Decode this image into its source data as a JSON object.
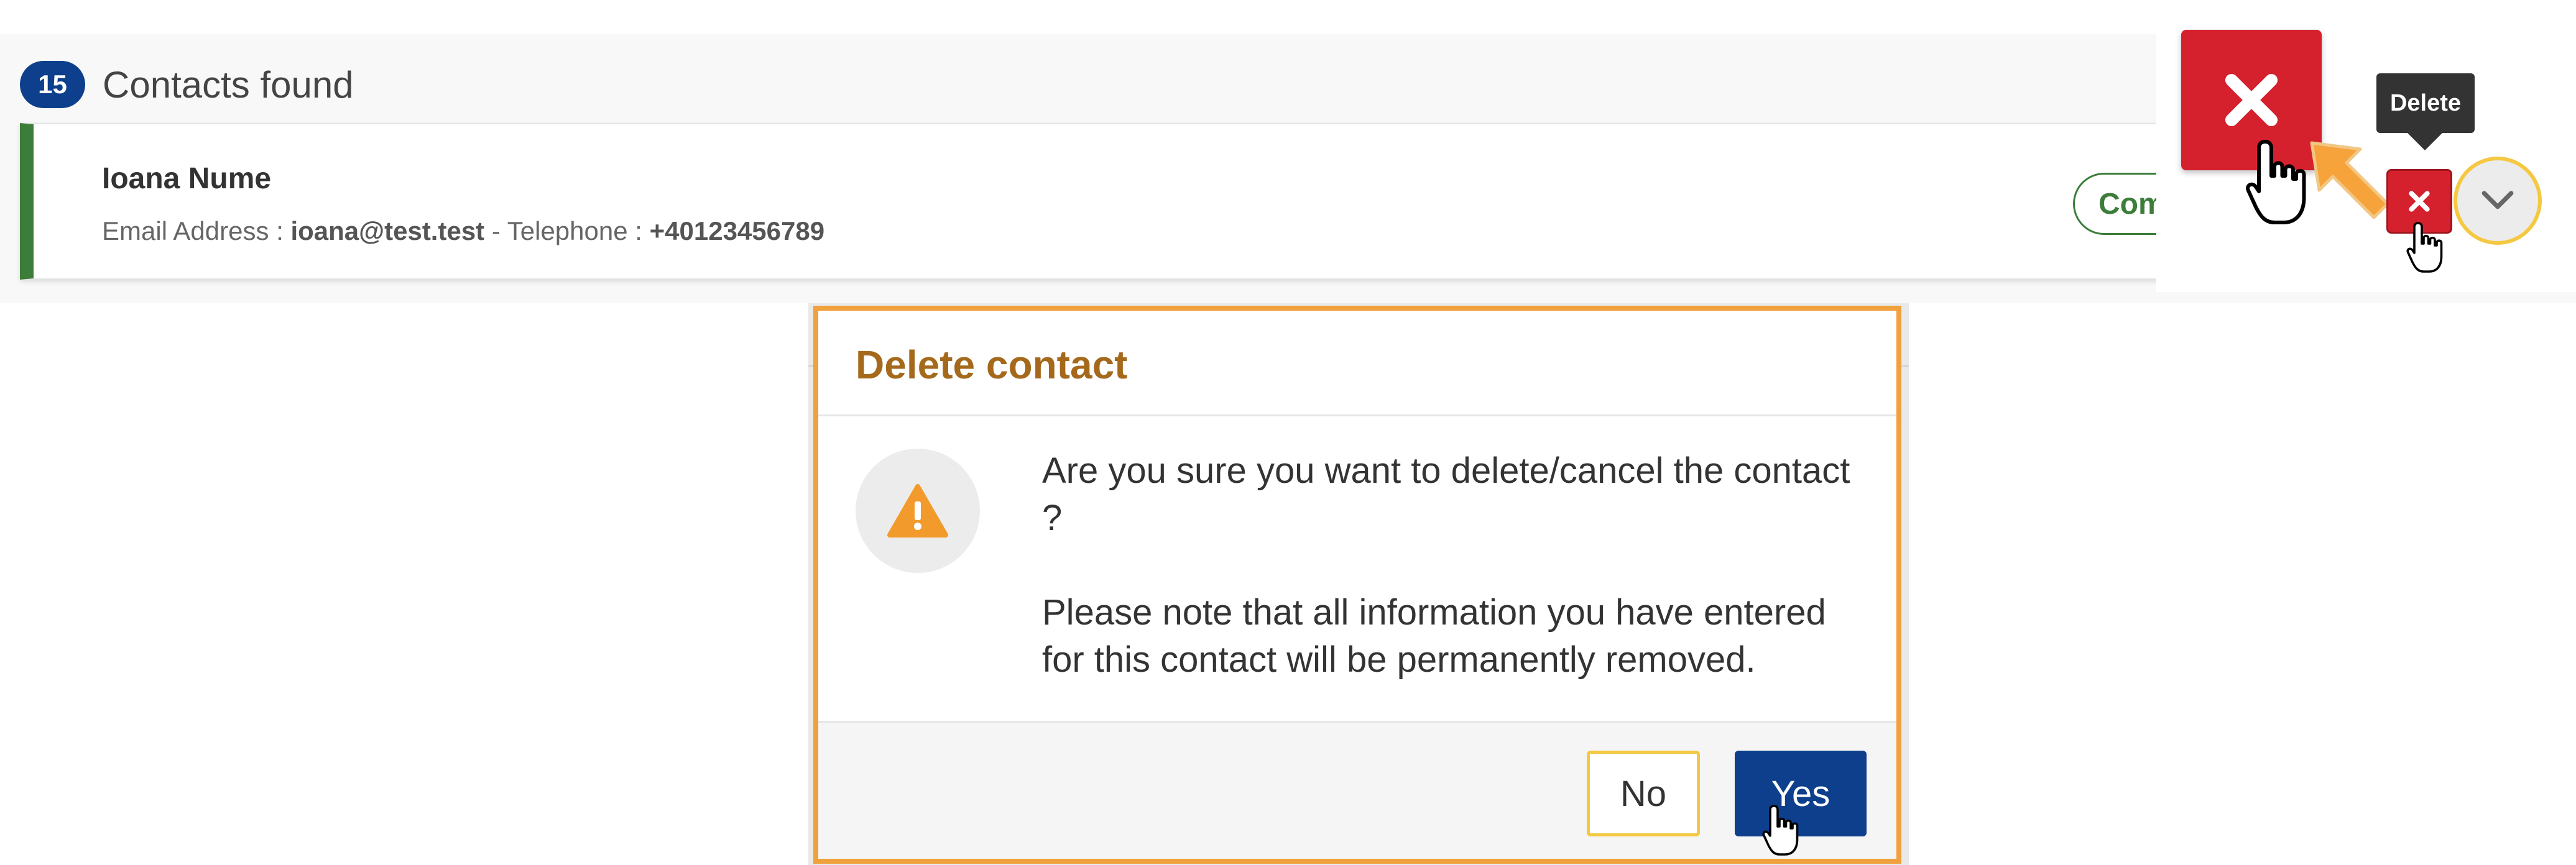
{
  "results": {
    "count": "15",
    "title": "Contacts found"
  },
  "contact": {
    "name": "Ioana Nume",
    "email_label": "Email Address : ",
    "email": "ioana@test.test",
    "separator": " - ",
    "phone_label": "Telephone : ",
    "phone": "+40123456789",
    "status_label": "Com",
    "status_color": "#3c7d3a"
  },
  "actions": {
    "delete_tooltip": "Delete",
    "delete_icon": "close-x-icon",
    "expand_icon": "chevron-down-icon",
    "delete_color": "#d5202e"
  },
  "dialog": {
    "title": "Delete contact",
    "icon": "warning-icon",
    "message_1": "Are you sure you want to delete/cancel the contact ?",
    "message_2": "Please note that all information you have entered for this contact will be permanently removed.",
    "no_label": "No",
    "yes_label": "Yes",
    "accent_color": "#f0a03c",
    "primary_color": "#0d3f8c"
  }
}
